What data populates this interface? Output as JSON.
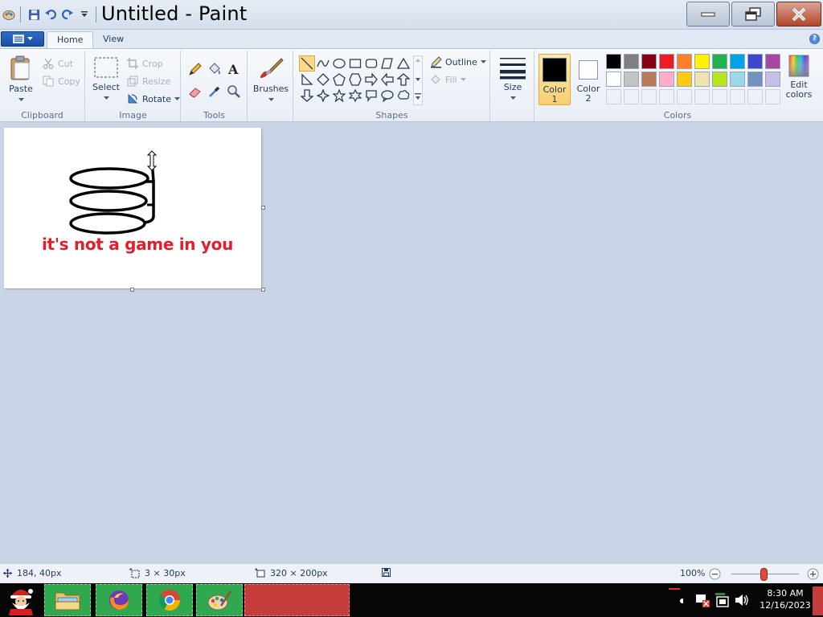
{
  "window": {
    "title": "Untitled - Paint"
  },
  "tabs": {
    "home": "Home",
    "view": "View"
  },
  "ribbon": {
    "clipboard": {
      "label": "Clipboard",
      "paste": "Paste",
      "cut": "Cut",
      "copy": "Copy"
    },
    "image": {
      "label": "Image",
      "select": "Select",
      "crop": "Crop",
      "resize": "Resize",
      "rotate": "Rotate"
    },
    "tools": {
      "label": "Tools"
    },
    "brushes": "Brushes",
    "shapes": {
      "label": "Shapes",
      "outline": "Outline",
      "fill": "Fill"
    },
    "size": "Size",
    "colors": {
      "label": "Colors",
      "color1_a": "Color",
      "color1_b": "1",
      "color2_a": "Color",
      "color2_b": "2",
      "edit_a": "Edit",
      "edit_b": "colors",
      "palette_row1": [
        "#000000",
        "#7f7f7f",
        "#880015",
        "#ed1c24",
        "#ff7f27",
        "#fff200",
        "#22b14c",
        "#00a2e8",
        "#3f48cc",
        "#a349a4"
      ],
      "palette_row2": [
        "#ffffff",
        "#c3c3c3",
        "#b97a57",
        "#ffaec9",
        "#ffc90e",
        "#efe4b0",
        "#b5e61d",
        "#99d9ea",
        "#7092be",
        "#c8bfe7"
      ]
    }
  },
  "canvas": {
    "text": "it's not a game in you",
    "text_color": "#e0202b"
  },
  "status": {
    "cursor_pos": "184, 40px",
    "selection_size": "3 × 30px",
    "image_size": "320 × 200px",
    "zoom": "100%"
  },
  "taskbar": {
    "time": "8:30 AM",
    "date": "12/16/2023"
  }
}
